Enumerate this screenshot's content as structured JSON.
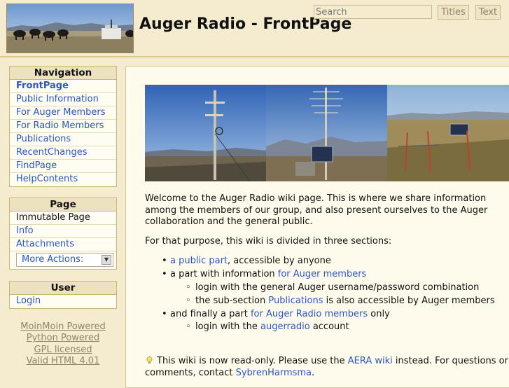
{
  "header": {
    "site_title": "Auger Radio - FrontPage",
    "search_placeholder": "Search",
    "titles_button": "Titles",
    "text_button": "Text"
  },
  "navigation": {
    "title": "Navigation",
    "items": [
      {
        "label": "FrontPage"
      },
      {
        "label": "Public Information"
      },
      {
        "label": "For Auger Members"
      },
      {
        "label": "For Radio Members"
      },
      {
        "label": "Publications"
      },
      {
        "label": "RecentChanges"
      },
      {
        "label": "FindPage"
      },
      {
        "label": "HelpContents"
      }
    ]
  },
  "page_panel": {
    "title": "Page",
    "items": [
      {
        "label": "Immutable Page"
      },
      {
        "label": "Info"
      },
      {
        "label": "Attachments"
      }
    ],
    "more_actions": "More Actions:"
  },
  "user_panel": {
    "title": "User",
    "login": "Login"
  },
  "credits": [
    "MoinMoin Powered",
    "Python Powered",
    "GPL licensed",
    "Valid HTML 4.01"
  ],
  "content": {
    "intro": "Welcome to the Auger Radio wiki page. This is where we share information among the members of our group, and also present ourselves to the Auger collaboration and the general public.",
    "sections_intro": "For that purpose, this wiki is divided in three sections:",
    "s1_link": "a public part",
    "s1_rest": ", accessible by anyone",
    "s2_pre": "a part with information ",
    "s2_link": "for Auger members",
    "s2_sub1": "login with the general Auger username/password combination",
    "s2_sub2_pre": "the sub-section ",
    "s2_sub2_link": "Publications",
    "s2_sub2_rest": " is also accessible by Auger members",
    "s3_pre": "and finally a part ",
    "s3_link": "for Auger Radio members",
    "s3_rest": " only",
    "s3_sub1_pre": "login with the ",
    "s3_sub1_link": "augerradio",
    "s3_sub1_rest": " account",
    "notice_pre": "This wiki is now read-only. Please use the ",
    "notice_link": "AERA wiki",
    "notice_mid": " instead. For questions or comments, contact ",
    "notice_contact": "SybrenHarmsma",
    "notice_end": "."
  },
  "colors": {
    "background": "#f5ecd0",
    "content_background": "#fffbec",
    "link": "#2a55c7",
    "panel_header": "#ede2bf"
  }
}
